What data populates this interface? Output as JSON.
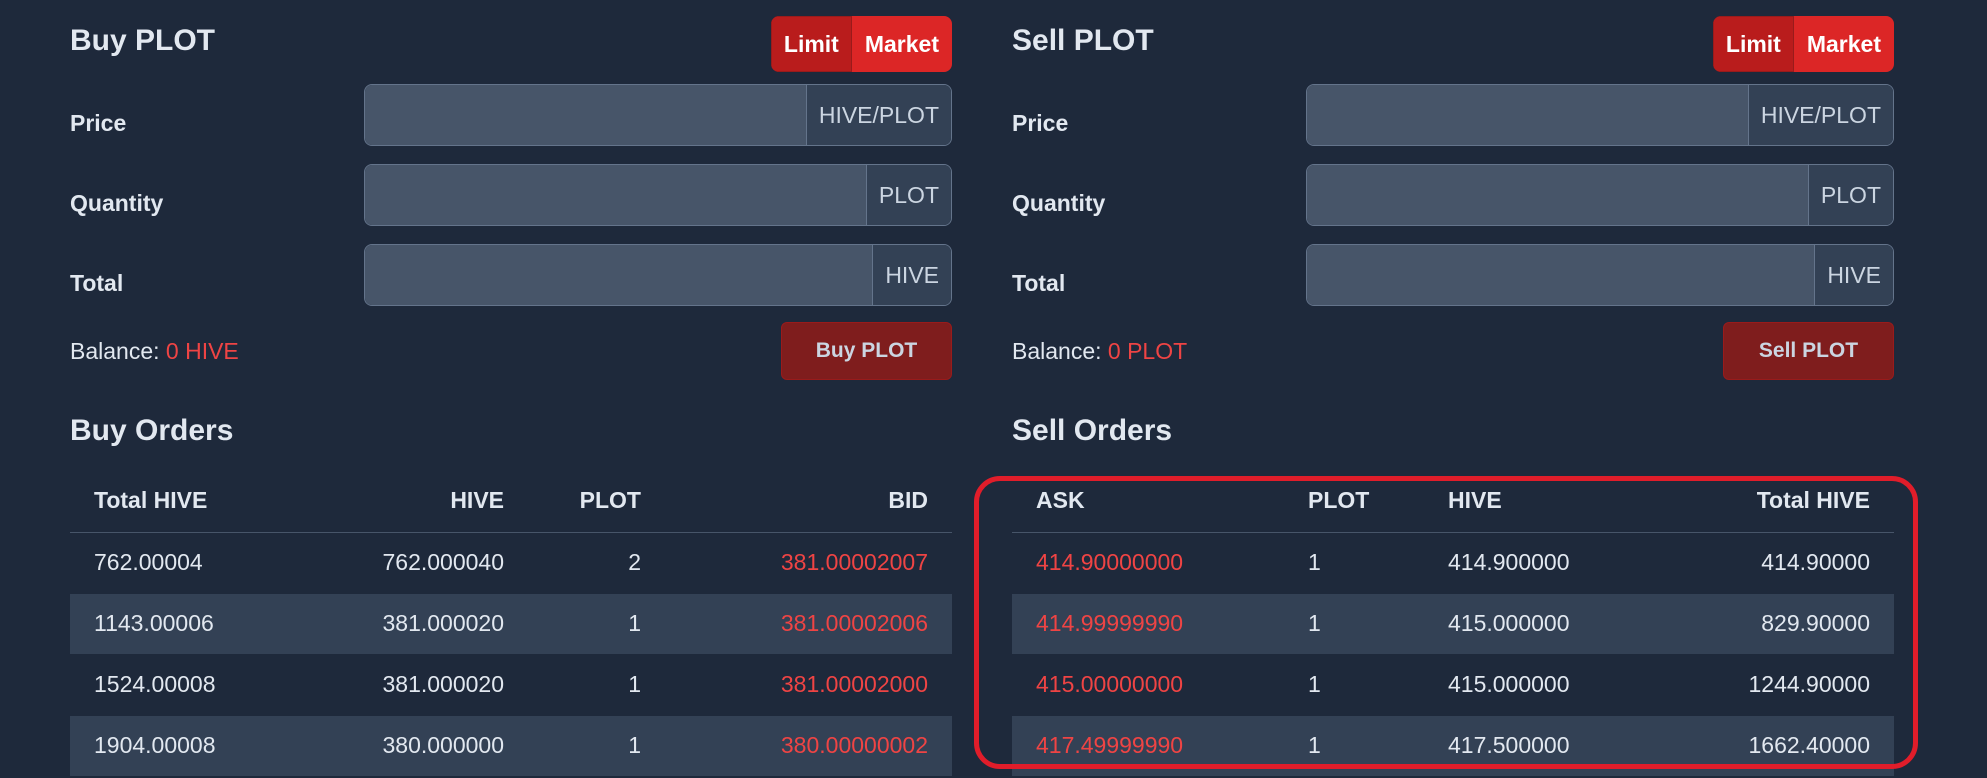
{
  "colors": {
    "background": "#1e293b",
    "accent_red": "#ef4444",
    "button_red": "#dc2626",
    "highlight": "#e11d2a"
  },
  "buy": {
    "title": "Buy PLOT",
    "mode": {
      "limit": "Limit",
      "market": "Market"
    },
    "price": {
      "label": "Price",
      "suffix": "HIVE/PLOT",
      "value": ""
    },
    "quantity": {
      "label": "Quantity",
      "suffix": "PLOT",
      "value": ""
    },
    "total": {
      "label": "Total",
      "suffix": "HIVE",
      "value": ""
    },
    "balance_label": "Balance:",
    "balance_value": "0 HIVE",
    "action_label": "Buy PLOT"
  },
  "sell": {
    "title": "Sell PLOT",
    "mode": {
      "limit": "Limit",
      "market": "Market"
    },
    "price": {
      "label": "Price",
      "suffix": "HIVE/PLOT",
      "value": ""
    },
    "quantity": {
      "label": "Quantity",
      "suffix": "PLOT",
      "value": ""
    },
    "total": {
      "label": "Total",
      "suffix": "HIVE",
      "value": ""
    },
    "balance_label": "Balance:",
    "balance_value": "0 PLOT",
    "action_label": "Sell PLOT"
  },
  "buy_orders": {
    "title": "Buy Orders",
    "headers": [
      "Total HIVE",
      "HIVE",
      "PLOT",
      "BID"
    ],
    "rows": [
      [
        "762.00004",
        "762.000040",
        "2",
        "381.00002007"
      ],
      [
        "1143.00006",
        "381.000020",
        "1",
        "381.00002006"
      ],
      [
        "1524.00008",
        "381.000020",
        "1",
        "381.00002000"
      ],
      [
        "1904.00008",
        "380.000000",
        "1",
        "380.00000002"
      ]
    ]
  },
  "sell_orders": {
    "title": "Sell Orders",
    "headers": [
      "ASK",
      "PLOT",
      "HIVE",
      "Total HIVE"
    ],
    "rows": [
      [
        "414.90000000",
        "1",
        "414.900000",
        "414.90000"
      ],
      [
        "414.99999990",
        "1",
        "415.000000",
        "829.90000"
      ],
      [
        "415.00000000",
        "1",
        "415.000000",
        "1244.90000"
      ],
      [
        "417.49999990",
        "1",
        "417.500000",
        "1662.40000"
      ]
    ]
  }
}
